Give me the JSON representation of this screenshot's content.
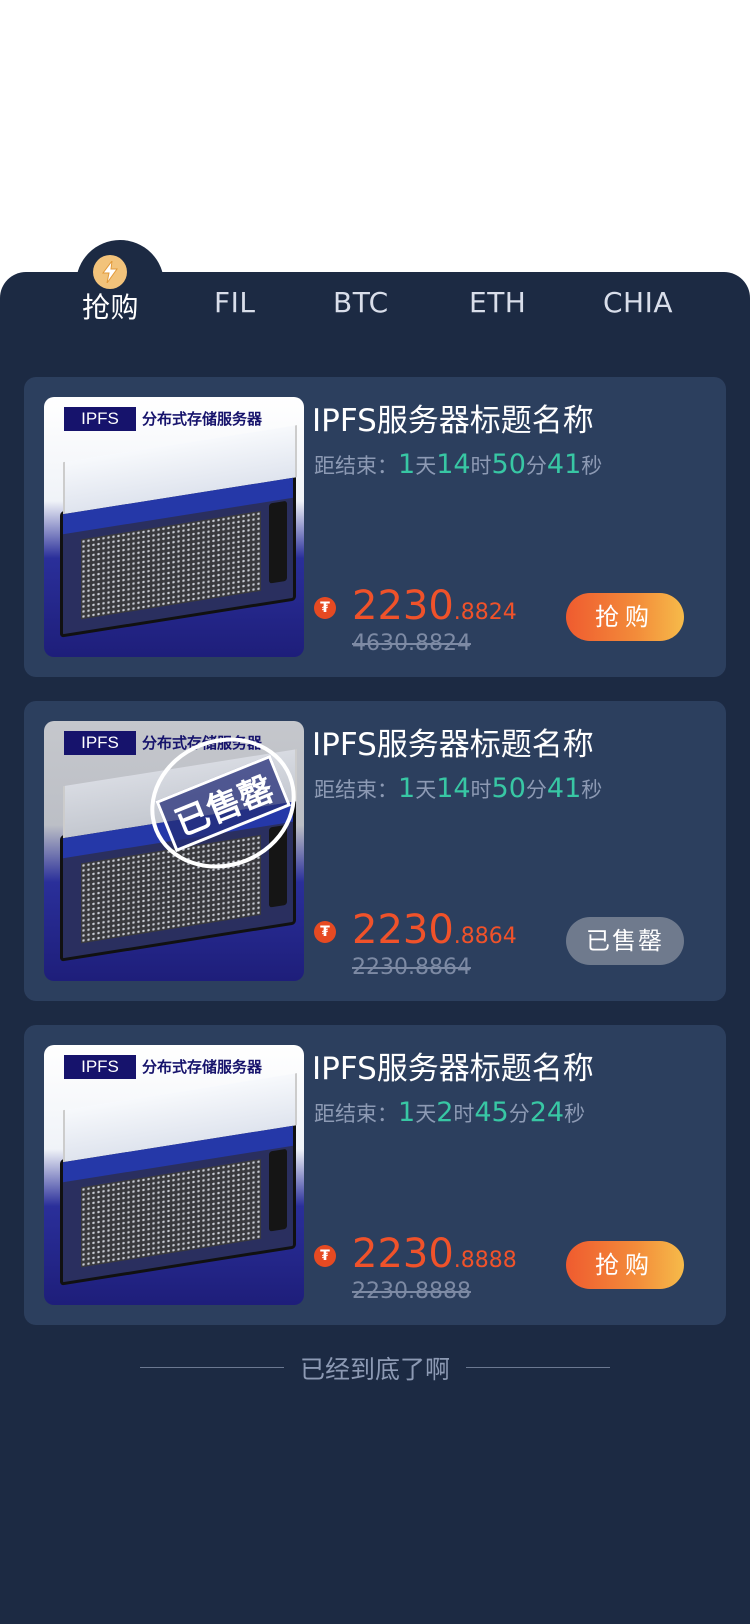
{
  "tabs": [
    {
      "label": "抢购",
      "active": true
    },
    {
      "label": "FIL",
      "active": false
    },
    {
      "label": "BTC",
      "active": false
    },
    {
      "label": "ETH",
      "active": false
    },
    {
      "label": "CHIA",
      "active": false
    }
  ],
  "products": [
    {
      "image_label": "IPFS",
      "image_sub": "分布式存储服务器",
      "title": "IPFS服务器标题名称",
      "countdown_label": "距结束：",
      "days": "1",
      "day_unit": "天",
      "hours": "14",
      "hour_unit": "时",
      "minutes": "50",
      "minute_unit": "分",
      "seconds": "41",
      "second_unit": "秒",
      "coin_symbol": "₮",
      "price_int": "2230",
      "price_dec": ".8824",
      "old_price": "4630.8824",
      "button": "抢购"
    },
    {
      "image_label": "IPFS",
      "image_sub": "分布式存储服务器",
      "stamp": "已售罄",
      "title": "IPFS服务器标题名称",
      "countdown_label": "距结束：",
      "days": "1",
      "day_unit": "天",
      "hours": "14",
      "hour_unit": "时",
      "minutes": "50",
      "minute_unit": "分",
      "seconds": "41",
      "second_unit": "秒",
      "coin_symbol": "₮",
      "price_int": "2230",
      "price_dec": ".8864",
      "old_price": "2230.8864",
      "button": "已售罄"
    },
    {
      "image_label": "IPFS",
      "image_sub": "分布式存储服务器",
      "title": "IPFS服务器标题名称",
      "countdown_label": "距结束：",
      "days": "1",
      "day_unit": "天",
      "hours": "2",
      "hour_unit": "时",
      "minutes": "45",
      "minute_unit": "分",
      "seconds": "24",
      "second_unit": "秒",
      "coin_symbol": "₮",
      "price_int": "2230",
      "price_dec": ".8888",
      "old_price": "2230.8888",
      "button": "抢购"
    }
  ],
  "footer": {
    "end_text": "已经到底了啊"
  },
  "colors": {
    "panel": "#1c2a43",
    "card": "#2c3f5e",
    "accent_price": "#f0522a",
    "countdown_number": "#38c7a4",
    "buy_button_gradient": [
      "#ef5b2f",
      "#f6bb4a"
    ],
    "soldout_button": "#6f7a8d"
  },
  "icons": {
    "tab_active": "lightning-icon",
    "coin": "tether-coin-icon"
  }
}
